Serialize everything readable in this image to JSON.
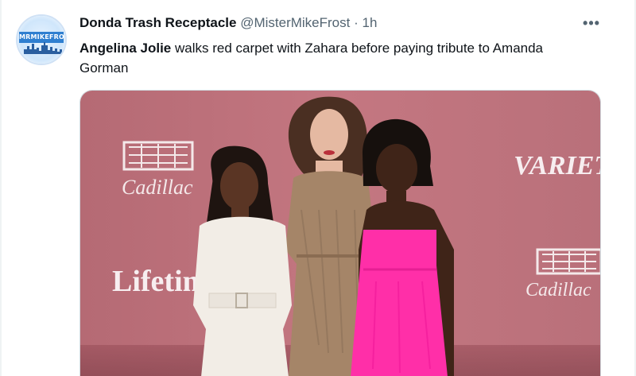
{
  "tweet": {
    "avatar_text": "MRMIKEFROST",
    "display_name": "Donda Trash Receptacle",
    "handle": "@MisterMikeFrost",
    "separator": "·",
    "time": "1h",
    "more_icon": "more-horizontal-icon",
    "text_bold": "Angelina Jolie",
    "text_rest": " walks red carpet with Zahara before paying tribute to Amanda Gorman"
  },
  "media": {
    "backdrop_logos": {
      "cadillac_left": "Cadillac",
      "cadillac_right": "Cadillac",
      "variety": "VARIET",
      "lifetime": "Lifetim"
    }
  },
  "colors": {
    "backdrop": "#c06e78",
    "text_secondary": "#536471",
    "pink_dress": "#ff2fa8"
  }
}
